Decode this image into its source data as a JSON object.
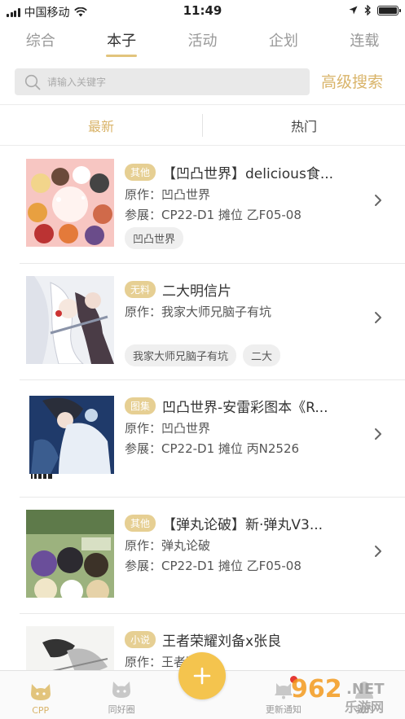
{
  "status_bar": {
    "carrier": "中国移动",
    "time": "11:49"
  },
  "top_tabs": [
    {
      "label": "综合",
      "active": false
    },
    {
      "label": "本子",
      "active": true
    },
    {
      "label": "活动",
      "active": false
    },
    {
      "label": "企划",
      "active": false
    },
    {
      "label": "连载",
      "active": false
    }
  ],
  "search": {
    "placeholder": "请输入关键字",
    "advanced_label": "高级搜索"
  },
  "sub_tabs": [
    {
      "label": "最新",
      "active": true
    },
    {
      "label": "热门",
      "active": false
    }
  ],
  "items": [
    {
      "badge": "其他",
      "title": "【凹凸世界】delicious食...",
      "origin": "原作：凹凸世界",
      "exhibit": "参展：CP22-D1 摊位 乙F05-08",
      "tags": [
        "凹凸世界"
      ]
    },
    {
      "badge": "无料",
      "title": "二大明信片",
      "origin": "原作：我家大师兄脑子有坑",
      "exhibit": "",
      "tags": [
        "我家大师兄脑子有坑",
        "二大"
      ]
    },
    {
      "badge": "图集",
      "title": "凹凸世界-安雷彩图本《R...",
      "origin": "原作：凹凸世界",
      "exhibit": "参展：CP22-D1 摊位 丙N2526",
      "tags": []
    },
    {
      "badge": "其他",
      "title": "【弹丸论破】新·弹丸V3...",
      "origin": "原作：弹丸论破",
      "exhibit": "参展：CP22-D1 摊位 乙F05-08",
      "tags": []
    },
    {
      "badge": "小说",
      "title": "王者荣耀刘备x张良",
      "origin": "原作：王者荣耀",
      "exhibit": "",
      "tags": []
    }
  ],
  "tabbar": [
    {
      "label": "CPP",
      "icon": "cat-face-icon",
      "active": true
    },
    {
      "label": "同好圈",
      "icon": "circle-cat-icon",
      "active": false
    },
    {
      "label": "",
      "icon": "plus-icon",
      "active": false
    },
    {
      "label": "更新通知",
      "icon": "bell-cat-icon",
      "active": false
    },
    {
      "label": "我的",
      "icon": "profile-icon",
      "active": false
    }
  ],
  "colors": {
    "accent": "#d9b46a",
    "badge": "#e6cf93",
    "fab": "#f4c44e",
    "notification_dot": "#e53935"
  }
}
